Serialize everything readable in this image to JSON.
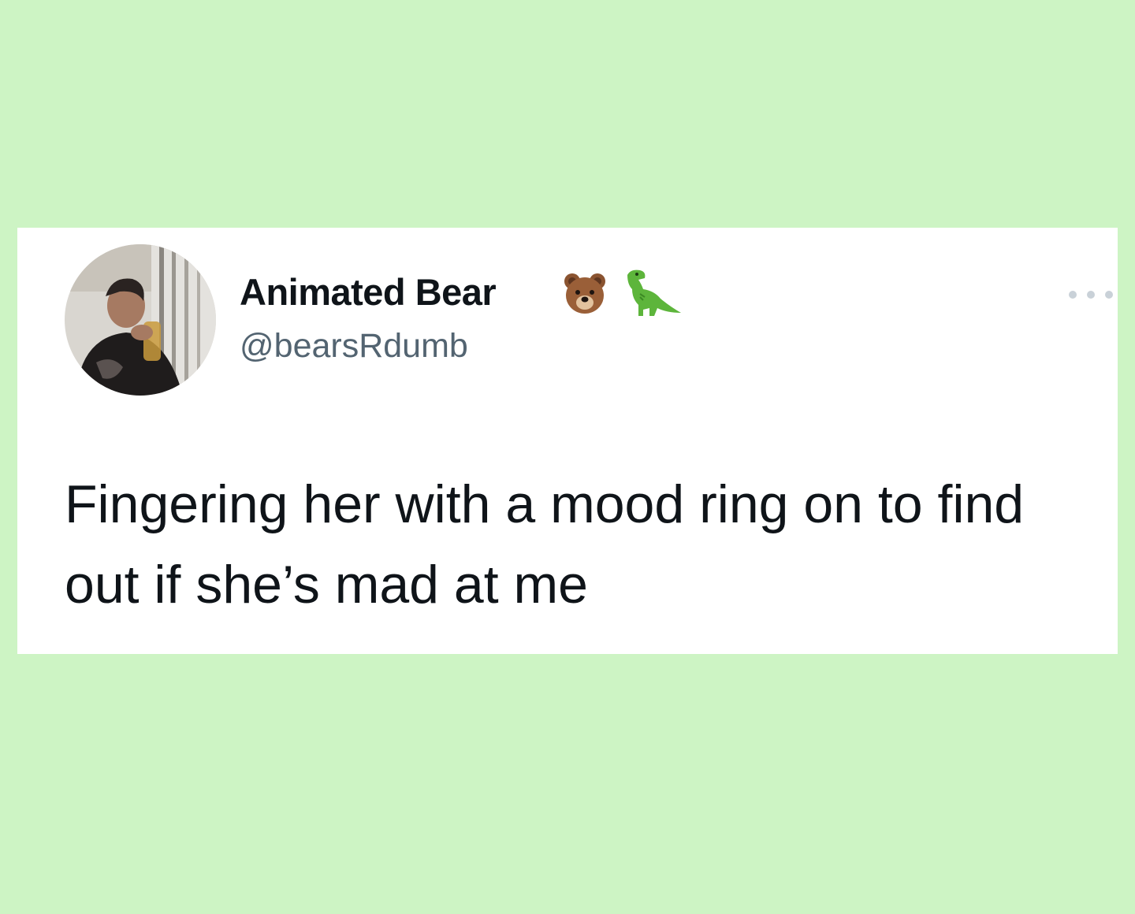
{
  "tweet": {
    "author_name": "Animated Bear",
    "name_emojis": [
      "bear-emoji",
      "t-rex-emoji"
    ],
    "handle": "@bearsRdumb",
    "text": "Fingering her with a mood ring on to find out if she’s mad at me",
    "more_icon": "more-horizontal-icon"
  },
  "colors": {
    "background": "#cdf4c4",
    "card": "#ffffff",
    "name_text": "#0f1419",
    "handle_text": "#536471",
    "more_dots": "#c9d1d8"
  }
}
